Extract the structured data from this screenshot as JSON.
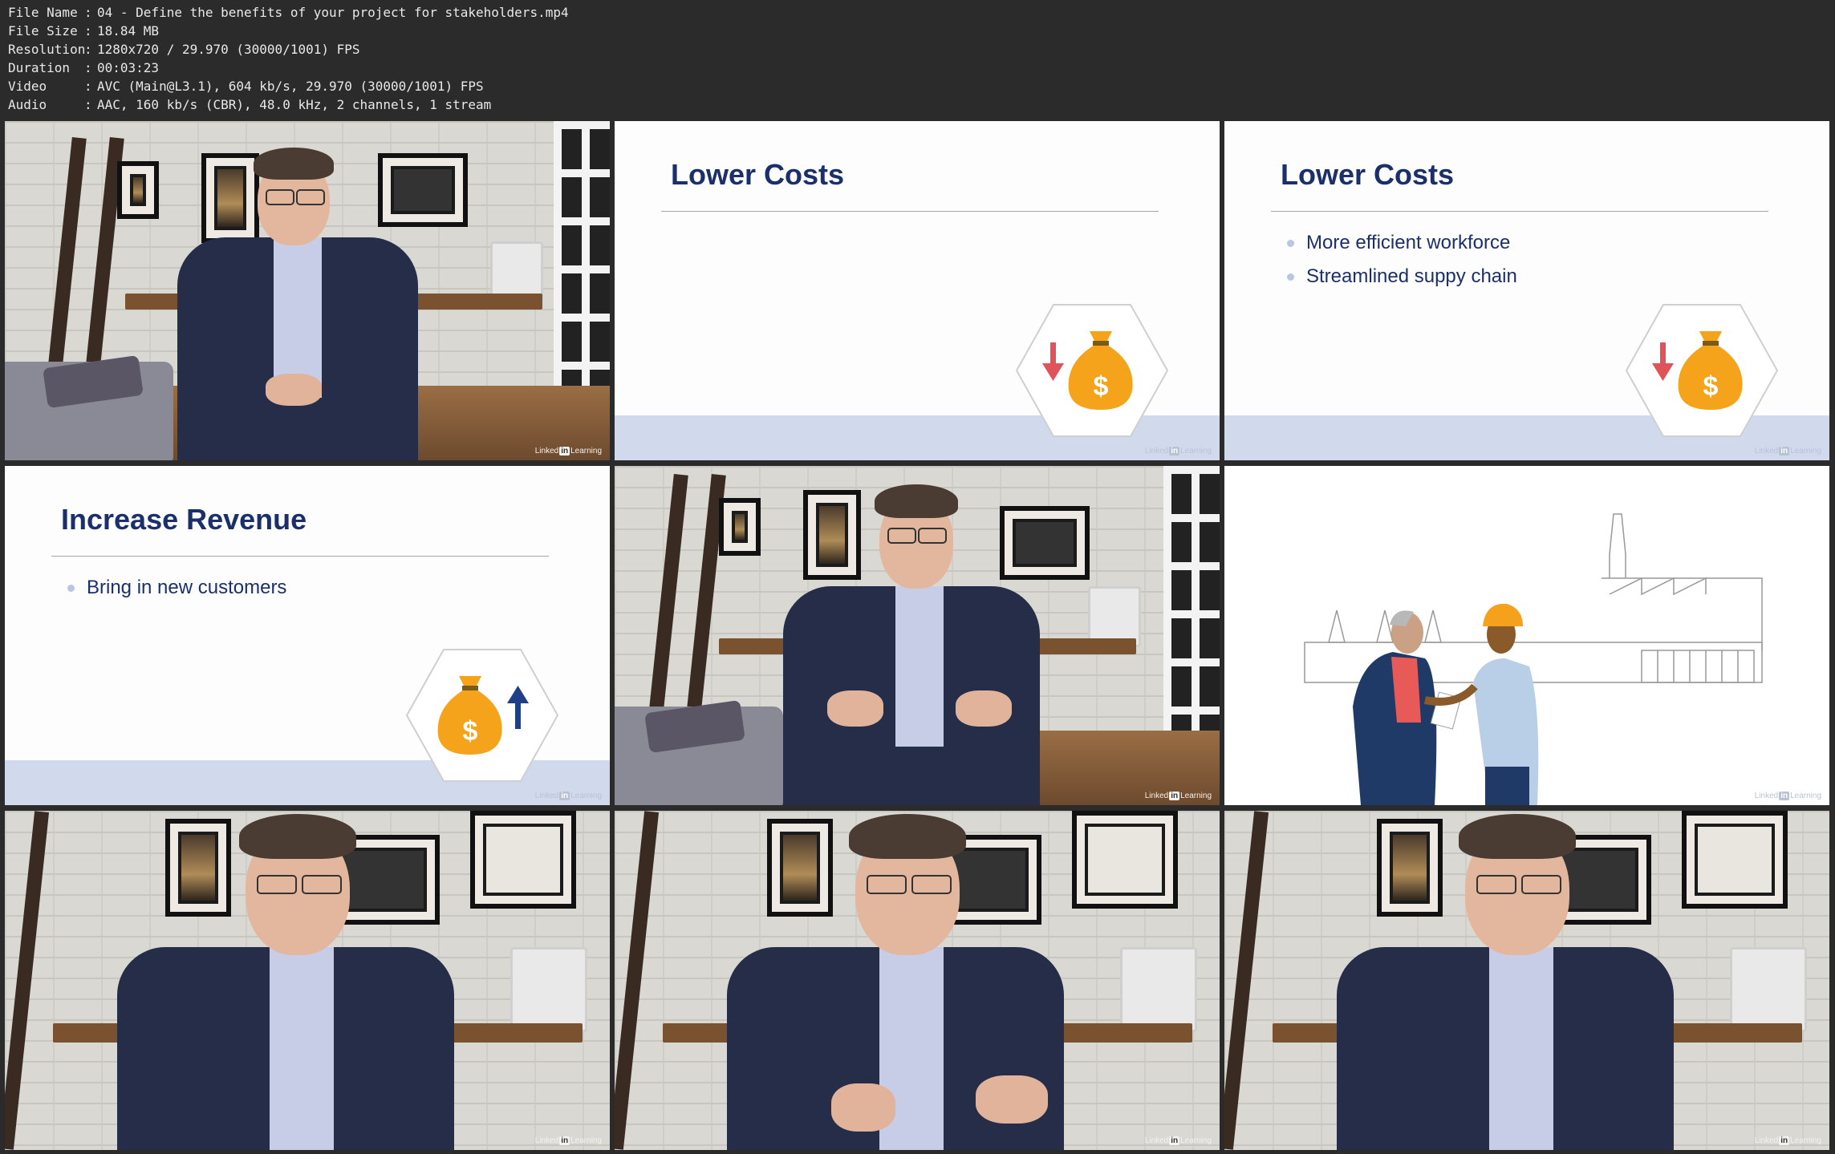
{
  "meta": {
    "rows": [
      {
        "key": "File Name",
        "value": "04 - Define the benefits of your project for stakeholders.mp4"
      },
      {
        "key": "File Size",
        "value": "18.84 MB"
      },
      {
        "key": "Resolution",
        "value": "1280x720 / 29.970 (30000/1001) FPS"
      },
      {
        "key": "Duration",
        "value": "00:03:23"
      },
      {
        "key": "Video",
        "value": "AVC (Main@L3.1), 604 kb/s, 29.970 (30000/1001) FPS"
      },
      {
        "key": "Audio",
        "value": "AAC, 160 kb/s (CBR), 48.0 kHz, 2 channels, 1 stream"
      }
    ]
  },
  "watermark": {
    "left": "Linked",
    "mid": "in",
    "right": "Learning"
  },
  "slides": {
    "lower_costs_1": {
      "title": "Lower Costs"
    },
    "lower_costs_2": {
      "title": "Lower Costs",
      "bullets": [
        "More efficient workforce",
        "Streamlined suppy chain"
      ]
    },
    "increase_revenue": {
      "title": "Increase Revenue",
      "bullets": [
        "Bring in new customers"
      ]
    }
  },
  "icons": {
    "money_bag": "money-bag-icon",
    "arrow_down": "arrow-down-icon",
    "arrow_up": "arrow-up-icon"
  },
  "colors": {
    "title": "#1b2f6b",
    "bag": "#f5a31a",
    "arrow_down": "#e0535a",
    "arrow_up": "#1f3f86",
    "band": "#d1daed"
  }
}
